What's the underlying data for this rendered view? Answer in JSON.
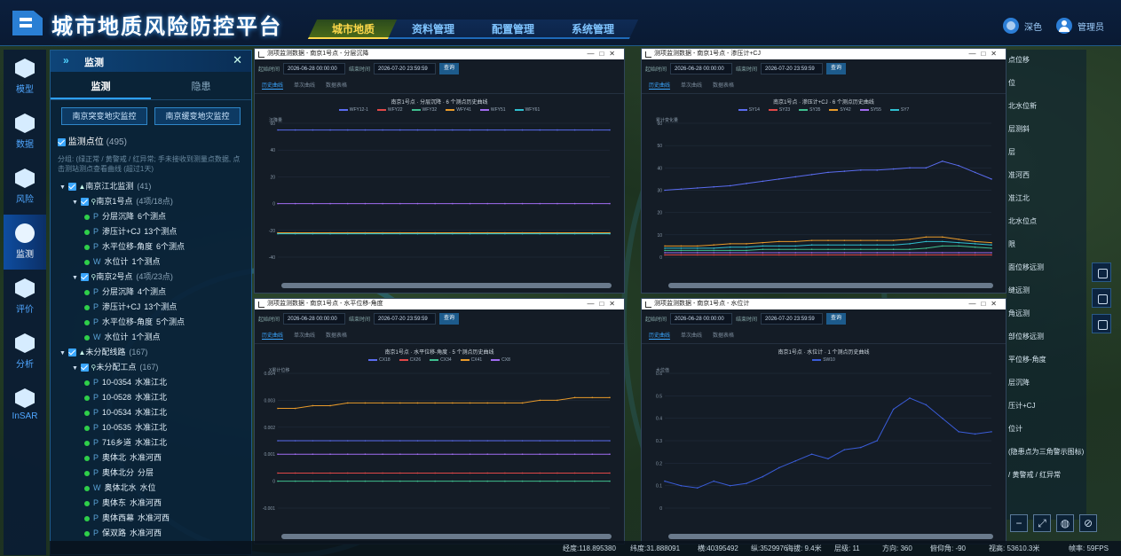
{
  "header": {
    "title": "城市地质风险防控平台",
    "tabs": [
      {
        "label": "城市地质",
        "active": true
      },
      {
        "label": "资料管理",
        "active": false
      },
      {
        "label": "配置管理",
        "active": false
      },
      {
        "label": "系统管理",
        "active": false
      }
    ],
    "theme_label": "深色",
    "user_label": "管理员"
  },
  "leftnav": [
    {
      "label": "模型",
      "icon": "cube-icon"
    },
    {
      "label": "数据",
      "icon": "chart-icon"
    },
    {
      "label": "风险",
      "icon": "warning-icon"
    },
    {
      "label": "监测",
      "icon": "monitor-icon",
      "active": true
    },
    {
      "label": "评价",
      "icon": "edit-icon"
    },
    {
      "label": "分析",
      "icon": "pie-icon"
    },
    {
      "label": "InSAR",
      "icon": "insar-icon"
    }
  ],
  "panel": {
    "title": "监测",
    "tabs": [
      "监测",
      "隐患"
    ],
    "buttons": [
      "南京突变地灾监控",
      "南京缓变地灾监控"
    ],
    "points_label": "监测点位",
    "points_count": "(495)",
    "legend_note": "分组: (绿正常 / 黄警戒 / 红异常; 手未接收到测量点数据, 点击测站测点查看曲线 (超过1天)",
    "tree": [
      {
        "indent": 0,
        "type": "group",
        "label": "南京江北监测",
        "count": "(41)"
      },
      {
        "indent": 1,
        "type": "site",
        "label": "南京1号点",
        "count": "(4项/18点)"
      },
      {
        "indent": 2,
        "type": "item",
        "tag": "P",
        "label": "分层沉降",
        "extra": "6个测点"
      },
      {
        "indent": 2,
        "type": "item",
        "tag": "P",
        "label": "渗压计+CJ",
        "extra": "13个测点"
      },
      {
        "indent": 2,
        "type": "item",
        "tag": "P",
        "label": "水平位移-角度",
        "extra": "6个测点"
      },
      {
        "indent": 2,
        "type": "item",
        "tag": "W",
        "label": "水位计",
        "extra": "1个测点"
      },
      {
        "indent": 1,
        "type": "site",
        "label": "南京2号点",
        "count": "(4项/23点)"
      },
      {
        "indent": 2,
        "type": "item",
        "tag": "P",
        "label": "分层沉降",
        "extra": "4个测点"
      },
      {
        "indent": 2,
        "type": "item",
        "tag": "P",
        "label": "渗压计+CJ",
        "extra": "13个测点"
      },
      {
        "indent": 2,
        "type": "item",
        "tag": "P",
        "label": "水平位移-角度",
        "extra": "5个测点"
      },
      {
        "indent": 2,
        "type": "item",
        "tag": "W",
        "label": "水位计",
        "extra": "1个测点"
      },
      {
        "indent": 0,
        "type": "group",
        "label": "未分配线路",
        "count": "(167)"
      },
      {
        "indent": 1,
        "type": "site",
        "label": "未分配工点",
        "count": "(167)"
      },
      {
        "indent": 2,
        "type": "item",
        "tag": "P",
        "label": "10-0354",
        "extra": "水准江北"
      },
      {
        "indent": 2,
        "type": "item",
        "tag": "P",
        "label": "10-0528",
        "extra": "水准江北"
      },
      {
        "indent": 2,
        "type": "item",
        "tag": "P",
        "label": "10-0534",
        "extra": "水准江北"
      },
      {
        "indent": 2,
        "type": "item",
        "tag": "P",
        "label": "10-0535",
        "extra": "水准江北"
      },
      {
        "indent": 2,
        "type": "item",
        "tag": "P",
        "label": "716乡道",
        "extra": "水准江北"
      },
      {
        "indent": 2,
        "type": "item",
        "tag": "P",
        "label": "奥体北",
        "extra": "水准河西"
      },
      {
        "indent": 2,
        "type": "item",
        "tag": "P",
        "label": "奥体北分",
        "extra": "分层"
      },
      {
        "indent": 2,
        "type": "item",
        "tag": "W",
        "label": "奥体北水",
        "extra": "水位"
      },
      {
        "indent": 2,
        "type": "item",
        "tag": "P",
        "label": "奥体东",
        "extra": "水准河西"
      },
      {
        "indent": 2,
        "type": "item",
        "tag": "P",
        "label": "奥体西幕",
        "extra": "水准河西"
      },
      {
        "indent": 2,
        "type": "item",
        "tag": "P",
        "label": "保双路",
        "extra": "水准河西"
      }
    ]
  },
  "windows": [
    {
      "title": "测项监测数据 - 南京1号点 - 分层沉降",
      "start_label": "起始时间",
      "start": "2026-06-28 00:00:00",
      "end_label": "结束时间",
      "end": "2026-07-20 23:59:59",
      "query": "查询",
      "tabs": [
        "历史曲线",
        "单次曲线",
        "数据表格"
      ],
      "chart_title": "南京1号点 · 分层沉降 · 6 个测点历史曲线",
      "ylabel": "沉降量"
    },
    {
      "title": "测项监测数据 - 南京1号点 - 渗压计+CJ",
      "start_label": "起始时间",
      "start": "2026-06-28 00:00:00",
      "end_label": "结束时间",
      "end": "2026-07-20 23:59:59",
      "query": "查询",
      "tabs": [
        "历史曲线",
        "单次曲线",
        "数据表格"
      ],
      "chart_title": "南京1号点 · 渗压计+CJ · 6 个测点历史曲线",
      "ylabel": "累计变化量"
    },
    {
      "title": "测项监测数据 - 南京1号点 - 水平位移-角度",
      "start_label": "起始时间",
      "start": "2026-06-28 00:00:00",
      "end_label": "结束时间",
      "end": "2026-07-20 23:59:59",
      "query": "查询",
      "tabs": [
        "历史曲线",
        "单次曲线",
        "数据表格"
      ],
      "chart_title": "南京1号点 · 水平位移-角度 · 5 个测点历史曲线",
      "ylabel": "X累计位移"
    },
    {
      "title": "测项监测数据 - 南京1号点 - 水位计",
      "start_label": "起始时间",
      "start": "2026-06-28 00:00:00",
      "end_label": "结束时间",
      "end": "2026-07-20 23:59:59",
      "query": "查询",
      "tabs": [
        "历史曲线",
        "单次曲线",
        "数据表格"
      ],
      "chart_title": "南京1号点 · 水位计 · 1 个测点历史曲线",
      "ylabel": "水位值"
    }
  ],
  "chart_data": [
    {
      "type": "line",
      "title": "南京1号点 · 分层沉降 · 6 个测点历史曲线",
      "ylabel": "沉降量",
      "ylim": [
        -40,
        60
      ],
      "yticks": [
        60,
        40,
        20,
        0,
        -20,
        -40
      ],
      "series": [
        {
          "name": "WFY12-1",
          "color": "#5a6cf0",
          "values": [
            55,
            55,
            55,
            55,
            55,
            55,
            55,
            55,
            55,
            55,
            55,
            55,
            55,
            55,
            55,
            55,
            55,
            55,
            55,
            55
          ]
        },
        {
          "name": "WFY22",
          "color": "#e04848",
          "values": [
            -22,
            -22,
            -22,
            -22,
            -22,
            -22,
            -22,
            -22,
            -22,
            -22,
            -22,
            -22,
            -22,
            -22,
            -22,
            -22,
            -22,
            -22,
            -22,
            -22
          ]
        },
        {
          "name": "WFY32",
          "color": "#3fbf8f",
          "values": [
            -22.3,
            -22.3,
            -22.3,
            -22.3,
            -22.3,
            -22.3,
            -22.3,
            -22.3,
            -22.3,
            -22.3,
            -22.3,
            -22.3,
            -22.3,
            -22.3,
            -22.3,
            -22.3,
            -22.3,
            -22.3,
            -22.3,
            -22.3
          ]
        },
        {
          "name": "WFY41",
          "color": "#e89a2a",
          "values": [
            -21.8,
            -21.8,
            -21.8,
            -21.8,
            -21.8,
            -21.8,
            -21.8,
            -21.8,
            -21.8,
            -21.8,
            -21.8,
            -21.8,
            -21.8,
            -21.8,
            -21.8,
            -21.8,
            -21.8,
            -21.8,
            -21.8,
            -21.8
          ]
        },
        {
          "name": "WFY51",
          "color": "#a06cf0",
          "values": [
            0,
            0,
            0,
            0,
            0,
            0,
            0,
            0,
            0,
            0,
            0,
            0,
            0,
            0,
            0,
            0,
            0,
            0,
            0,
            0
          ]
        },
        {
          "name": "WFY61",
          "color": "#2fbfd0",
          "values": [
            -22.5,
            -22.5,
            -22.5,
            -22.5,
            -22.5,
            -22.5,
            -22.5,
            -22.5,
            -22.5,
            -22.5,
            -22.5,
            -22.5,
            -22.5,
            -22.5,
            -22.5,
            -22.5,
            -22.5,
            -22.5,
            -22.5,
            -22.5
          ]
        }
      ]
    },
    {
      "type": "line",
      "title": "南京1号点 · 渗压计+CJ · 6 个测点历史曲线",
      "ylabel": "累计变化量",
      "ylim": [
        0,
        60
      ],
      "yticks": [
        60,
        50,
        40,
        30,
        20,
        10,
        0
      ],
      "series": [
        {
          "name": "SY14",
          "color": "#5a6cf0",
          "values": [
            30,
            30.5,
            31,
            31.5,
            32,
            33,
            34,
            35,
            36,
            37,
            38,
            38.5,
            39,
            39,
            39.5,
            40,
            40,
            43,
            41,
            38,
            35
          ]
        },
        {
          "name": "SY23",
          "color": "#e04848",
          "values": [
            1,
            1,
            1,
            1,
            1,
            1,
            1,
            1,
            1,
            1,
            1,
            1,
            1,
            1,
            1,
            1,
            1,
            1,
            1,
            1,
            1
          ]
        },
        {
          "name": "SY35",
          "color": "#3fbf8f",
          "values": [
            3,
            3,
            3,
            3,
            3,
            3,
            3.5,
            3.5,
            3.5,
            3.5,
            3.5,
            3.5,
            3.5,
            3.5,
            3.5,
            3.5,
            4,
            5,
            5,
            4.5,
            4
          ]
        },
        {
          "name": "SY42",
          "color": "#e89a2a",
          "values": [
            5,
            5,
            5,
            5.5,
            6,
            6,
            6.5,
            7,
            7,
            7.5,
            7.5,
            7.5,
            7.5,
            7.5,
            7.5,
            8,
            9,
            9,
            8,
            7,
            6.5
          ]
        },
        {
          "name": "SY55",
          "color": "#a06cf0",
          "values": [
            2,
            2,
            2,
            2,
            2,
            2,
            2,
            2,
            2,
            2,
            2,
            2,
            2,
            2,
            2,
            2,
            2,
            2,
            2,
            2,
            2
          ]
        },
        {
          "name": "SY7",
          "color": "#2fbfd0",
          "values": [
            4,
            4,
            4,
            4,
            4.5,
            4.5,
            5,
            5,
            5,
            5.5,
            5.5,
            5.5,
            5.5,
            5.5,
            5.5,
            6,
            7,
            7,
            6.5,
            6,
            5.5
          ]
        }
      ]
    },
    {
      "type": "line",
      "title": "南京1号点 · 水平位移-角度 · 5 个测点历史曲线",
      "ylabel": "X累计位移",
      "ylim": [
        -0.001,
        0.004
      ],
      "yticks": [
        0.004,
        0.003,
        0.002,
        0.001,
        0,
        -0.001
      ],
      "series": [
        {
          "name": "CX18",
          "color": "#5a6cf0",
          "values": [
            0.0015,
            0.0015,
            0.0015,
            0.0015,
            0.0015,
            0.0015,
            0.0015,
            0.0015,
            0.0015,
            0.0015,
            0.0015,
            0.0015,
            0.0015,
            0.0015,
            0.0015,
            0.0015,
            0.0015,
            0.0015,
            0.0015,
            0.0015
          ]
        },
        {
          "name": "CX26",
          "color": "#e04848",
          "values": [
            0.0003,
            0.0003,
            0.0003,
            0.0003,
            0.0003,
            0.0003,
            0.0003,
            0.0003,
            0.0003,
            0.0003,
            0.0003,
            0.0003,
            0.0003,
            0.0003,
            0.0003,
            0.0003,
            0.0003,
            0.0003,
            0.0003,
            0.0003
          ]
        },
        {
          "name": "CX34",
          "color": "#3fbf8f",
          "values": [
            0,
            0,
            0,
            0,
            0,
            0,
            0,
            0,
            0,
            0,
            0,
            0,
            0,
            0,
            0,
            0,
            0,
            0,
            0,
            0
          ]
        },
        {
          "name": "CX41",
          "color": "#e89a2a",
          "values": [
            0.0027,
            0.0027,
            0.0028,
            0.0028,
            0.0029,
            0.0029,
            0.0029,
            0.0029,
            0.0029,
            0.0029,
            0.0029,
            0.0029,
            0.0029,
            0.0029,
            0.0029,
            0.003,
            0.003,
            0.0031,
            0.0031,
            0.0031
          ]
        },
        {
          "name": "CX8",
          "color": "#a06cf0",
          "values": [
            0.001,
            0.001,
            0.001,
            0.001,
            0.001,
            0.001,
            0.001,
            0.001,
            0.001,
            0.001,
            0.001,
            0.001,
            0.001,
            0.001,
            0.001,
            0.001,
            0.001,
            0.001,
            0.001,
            0.001
          ]
        }
      ]
    },
    {
      "type": "line",
      "title": "南京1号点 · 水位计 · 1 个测点历史曲线",
      "ylabel": "水位值",
      "ylim": [
        0,
        0.6
      ],
      "yticks": [
        0.6,
        0.5,
        0.4,
        0.3,
        0.2,
        0.1,
        0
      ],
      "series": [
        {
          "name": "SW10",
          "color": "#3a5cd8",
          "values": [
            0.12,
            0.1,
            0.09,
            0.12,
            0.1,
            0.11,
            0.14,
            0.18,
            0.21,
            0.24,
            0.22,
            0.26,
            0.27,
            0.3,
            0.44,
            0.49,
            0.46,
            0.4,
            0.34,
            0.33,
            0.34
          ]
        }
      ]
    }
  ],
  "right_list": [
    "点位移",
    "位",
    "北水位新",
    "层测斜",
    "层",
    "准河西",
    "准江北",
    "北水位点",
    "限",
    "面位移远测",
    "缝远测",
    "角远测",
    "部位移远测",
    "平位移-角度",
    "层沉降",
    "压计+CJ",
    "位计",
    "(隐患点为三角警示图标)",
    "/ 黄警戒 / 红异常"
  ],
  "statusbar": {
    "lon": "经度:118.895380",
    "lat": "纬度:31.888091",
    "x": "横:40395492",
    "y": "纵:3529976",
    "alt": "海拔: 9.4米",
    "level": "层级: 11",
    "dir": "方向: 360",
    "pitch": "俯仰角: -90",
    "view_h": "视高: 53610.3米",
    "fps": "帧率: 59FPS"
  }
}
